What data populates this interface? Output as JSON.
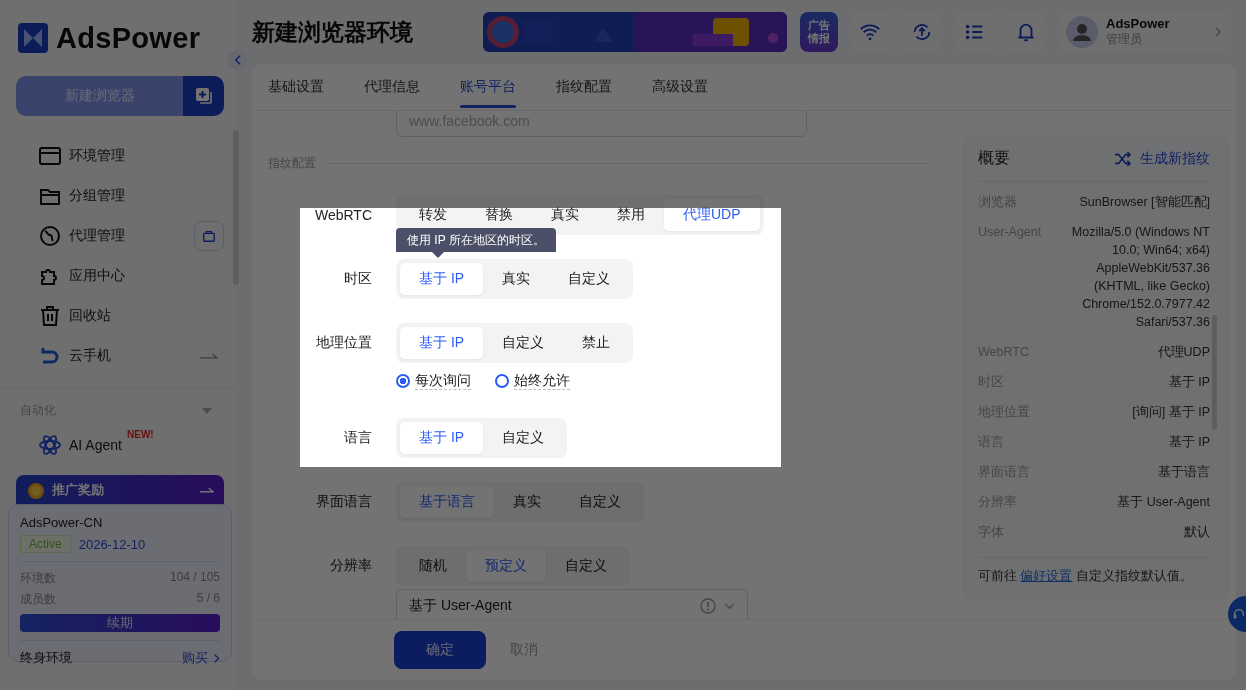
{
  "sidebar": {
    "logo": "AdsPower",
    "new_button": "新建浏览器",
    "nav": [
      {
        "label": "环境管理"
      },
      {
        "label": "分组管理"
      },
      {
        "label": "代理管理"
      },
      {
        "label": "应用中心"
      },
      {
        "label": "回收站"
      },
      {
        "label": "云手机"
      }
    ],
    "automation": {
      "title": "自动化",
      "items": [
        {
          "label": "AI Agent",
          "badge": "NEW!"
        }
      ]
    },
    "promo": {
      "title": "推广奖励"
    },
    "plan": {
      "name": "AdsPower-CN",
      "status": "Active",
      "expires": "2026-12-10",
      "stats": [
        {
          "label": "环境数",
          "value": "104 / 105"
        },
        {
          "label": "成员数",
          "value": "5 / 6"
        }
      ],
      "renew_button": "续期",
      "lifetime_label": "终身环境",
      "lifetime_link": "购买"
    }
  },
  "header": {
    "title": "新建浏览器环境",
    "ad_badge": "广告情报",
    "user": {
      "name": "AdsPower",
      "role": "管理员"
    }
  },
  "tabs": [
    {
      "label": "基础设置",
      "selected": false
    },
    {
      "label": "代理信息",
      "selected": false
    },
    {
      "label": "账号平台",
      "selected": true
    },
    {
      "label": "指纹配置",
      "selected": false
    },
    {
      "label": "高级设置",
      "selected": false
    }
  ],
  "form": {
    "account_placeholder": "www.facebook.com",
    "section": "指纹配置",
    "rows": [
      {
        "label": "WebRTC",
        "options": [
          {
            "label": "转发",
            "selected": false
          },
          {
            "label": "替换",
            "selected": false
          },
          {
            "label": "真实",
            "selected": false
          },
          {
            "label": "禁用",
            "selected": false
          },
          {
            "label": "代理UDP",
            "selected": true
          }
        ]
      },
      {
        "label": "时区",
        "options": [
          {
            "label": "基于 IP",
            "selected": true
          },
          {
            "label": "真实",
            "selected": false
          },
          {
            "label": "自定义",
            "selected": false
          }
        ]
      },
      {
        "label": "地理位置",
        "options": [
          {
            "label": "基于 IP",
            "selected": true
          },
          {
            "label": "自定义",
            "selected": false
          },
          {
            "label": "禁止",
            "selected": false
          }
        ],
        "radios": [
          {
            "label": "每次询问",
            "selected": true
          },
          {
            "label": "始终允许",
            "selected": false
          }
        ]
      },
      {
        "label": "语言",
        "options": [
          {
            "label": "基于 IP",
            "selected": true
          },
          {
            "label": "自定义",
            "selected": false
          }
        ]
      },
      {
        "label": "界面语言",
        "options": [
          {
            "label": "基于语言",
            "selected": true
          },
          {
            "label": "真实",
            "selected": false
          },
          {
            "label": "自定义",
            "selected": false
          }
        ]
      },
      {
        "label": "分辨率",
        "options": [
          {
            "label": "随机",
            "selected": false
          },
          {
            "label": "预定义",
            "selected": true
          },
          {
            "label": "自定义",
            "selected": false
          }
        ],
        "select": {
          "value": "基于 User-Agent"
        }
      }
    ],
    "tooltip": "使用 IP 所在地区的时区。"
  },
  "footer": {
    "confirm": "确定",
    "cancel": "取消"
  },
  "summary": {
    "title": "概要",
    "action": "生成新指纹",
    "items": [
      {
        "label": "浏览器",
        "value": "SunBrowser [智能匹配]"
      },
      {
        "label": "User-Agent",
        "value": "Mozilla/5.0 (Windows NT 10.0; Win64; x64) AppleWebKit/537.36 (KHTML, like Gecko) Chrome/152.0.7977.42 Safari/537.36"
      },
      {
        "label": "WebRTC",
        "value": "代理UDP"
      },
      {
        "label": "时区",
        "value": "基于 IP"
      },
      {
        "label": "地理位置",
        "value": "[询问] 基于 IP"
      },
      {
        "label": "语言",
        "value": "基于 IP"
      },
      {
        "label": "界面语言",
        "value": "基于语言"
      },
      {
        "label": "分辨率",
        "value": "基于 User-Agent"
      },
      {
        "label": "字体",
        "value": "默认"
      }
    ],
    "note_before": "可前往",
    "note_link": "偏好设置",
    "note_after": "自定义指纹默认值。"
  }
}
